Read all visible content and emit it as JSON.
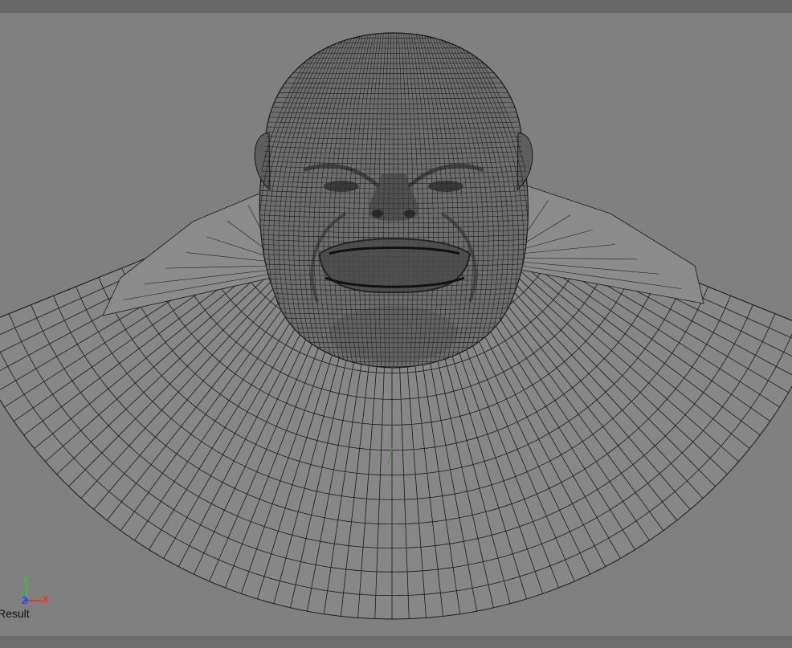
{
  "viewport": {
    "label": "Result",
    "background": "#808080"
  },
  "axis_gizmo": {
    "y_label": "Y",
    "z_label": "Z",
    "x_label": "X",
    "y_color": "#2ad02a",
    "z_color": "#2a46ff",
    "x_color": "#ff2a2a"
  },
  "model": {
    "icon": "sculpted-head-wireframe-icon",
    "wire_color": "#1a1a1a",
    "surface_color": "#8a8a8a"
  }
}
